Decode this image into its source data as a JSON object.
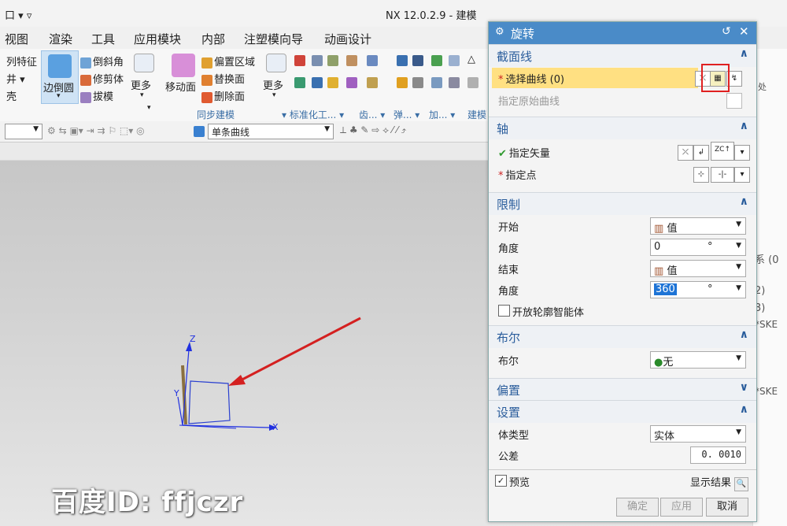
{
  "window": {
    "left_label": "口",
    "left_dropdown": "▾ ▿",
    "title": "NX 12.0.2.9 - 建模"
  },
  "menu": [
    "视图",
    "渲染",
    "工具",
    "应用模块",
    "内部",
    "注塑模向导",
    "动画设计"
  ],
  "ribbon": {
    "left_col": [
      "列特征",
      "井",
      "壳"
    ],
    "edge_blend": "边倒圆",
    "chamfer": "倒斜角",
    "trim_body": "修剪体",
    "draft": "拔模",
    "more1": "更多",
    "move_face": "移动面",
    "offset_region": "偏置区域",
    "replace_face": "替换面",
    "delete_face": "删除面",
    "more2": "更多",
    "group_sync": "同步建模",
    "group_std": "标准化工...",
    "group_gear": "齿...",
    "group_spring": "弹...",
    "group_add": "加...",
    "group_model": "建模",
    "processing": "处"
  },
  "toolbar2": {
    "filter_value": "单条曲线"
  },
  "right_panel": [
    "系 (0",
    "2)",
    "3)",
    "*SKE",
    "*SKE"
  ],
  "watermark": "百度ID: ffjczr",
  "dialog": {
    "title": "旋转",
    "sections": {
      "section_curve": "截面线",
      "axis": "轴",
      "limits": "限制",
      "boolean": "布尔",
      "offset": "偏置",
      "settings": "设置"
    },
    "select_curve": "选择曲线 (0)",
    "specify_origin_curve": "指定原始曲线",
    "specify_vector": "指定矢量",
    "specify_point": "指定点",
    "start_label": "开始",
    "start_value": "值",
    "angle_label": "角度",
    "start_angle": "0",
    "end_label": "结束",
    "end_value": "值",
    "end_angle": "360",
    "unit": "°",
    "open_profile": "开放轮廓智能体",
    "boolean_label": "布尔",
    "boolean_value": "无",
    "body_type_label": "体类型",
    "body_type_value": "实体",
    "tolerance_label": "公差",
    "tolerance_value": "0. 0010",
    "preview": "预览",
    "show_result": "显示结果",
    "ok": "确定",
    "apply": "应用",
    "cancel": "取消"
  },
  "axes": {
    "x": "X",
    "y": "Y",
    "z": "Z"
  }
}
